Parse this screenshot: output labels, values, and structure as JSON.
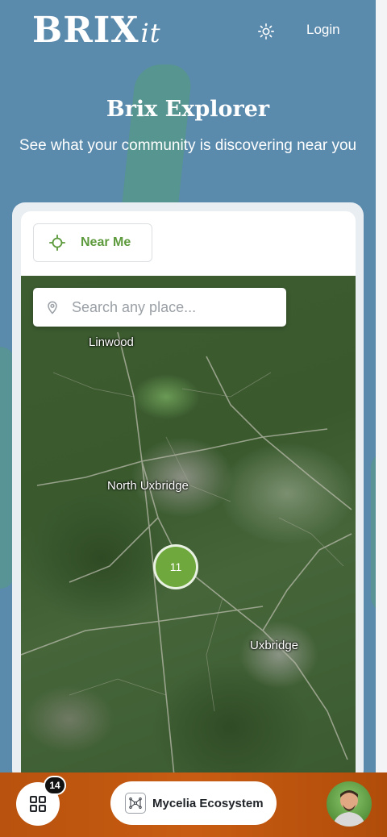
{
  "header": {
    "logo_main": "BRIX",
    "logo_suffix": "it",
    "theme_toggle_icon": "sun-icon",
    "login_label": "Login"
  },
  "hero": {
    "title": "Brix Explorer",
    "subtitle": "See what your community is discovering near you"
  },
  "explorer": {
    "near_me_label": "Near Me",
    "near_me_icon": "crosshair-icon",
    "search": {
      "placeholder": "Search any place...",
      "value": "",
      "icon": "location-pin-icon"
    },
    "map": {
      "labels": {
        "linwood": "Linwood",
        "north_uxbridge": "North Uxbridge",
        "uxbridge": "Uxbridge"
      },
      "cluster_count": "11"
    }
  },
  "bottom_bar": {
    "apps_icon": "grid-icon",
    "apps_badge": "14",
    "mycelia_label": "Mycelia Ecosystem",
    "mycelia_icon": "network-icon",
    "avatar_icon": "user-avatar"
  },
  "colors": {
    "background": "#5a8aac",
    "accent_green": "#5c9a3c",
    "cluster_green": "#6fa83c",
    "bottom_bar_orange": "#c85c12"
  }
}
